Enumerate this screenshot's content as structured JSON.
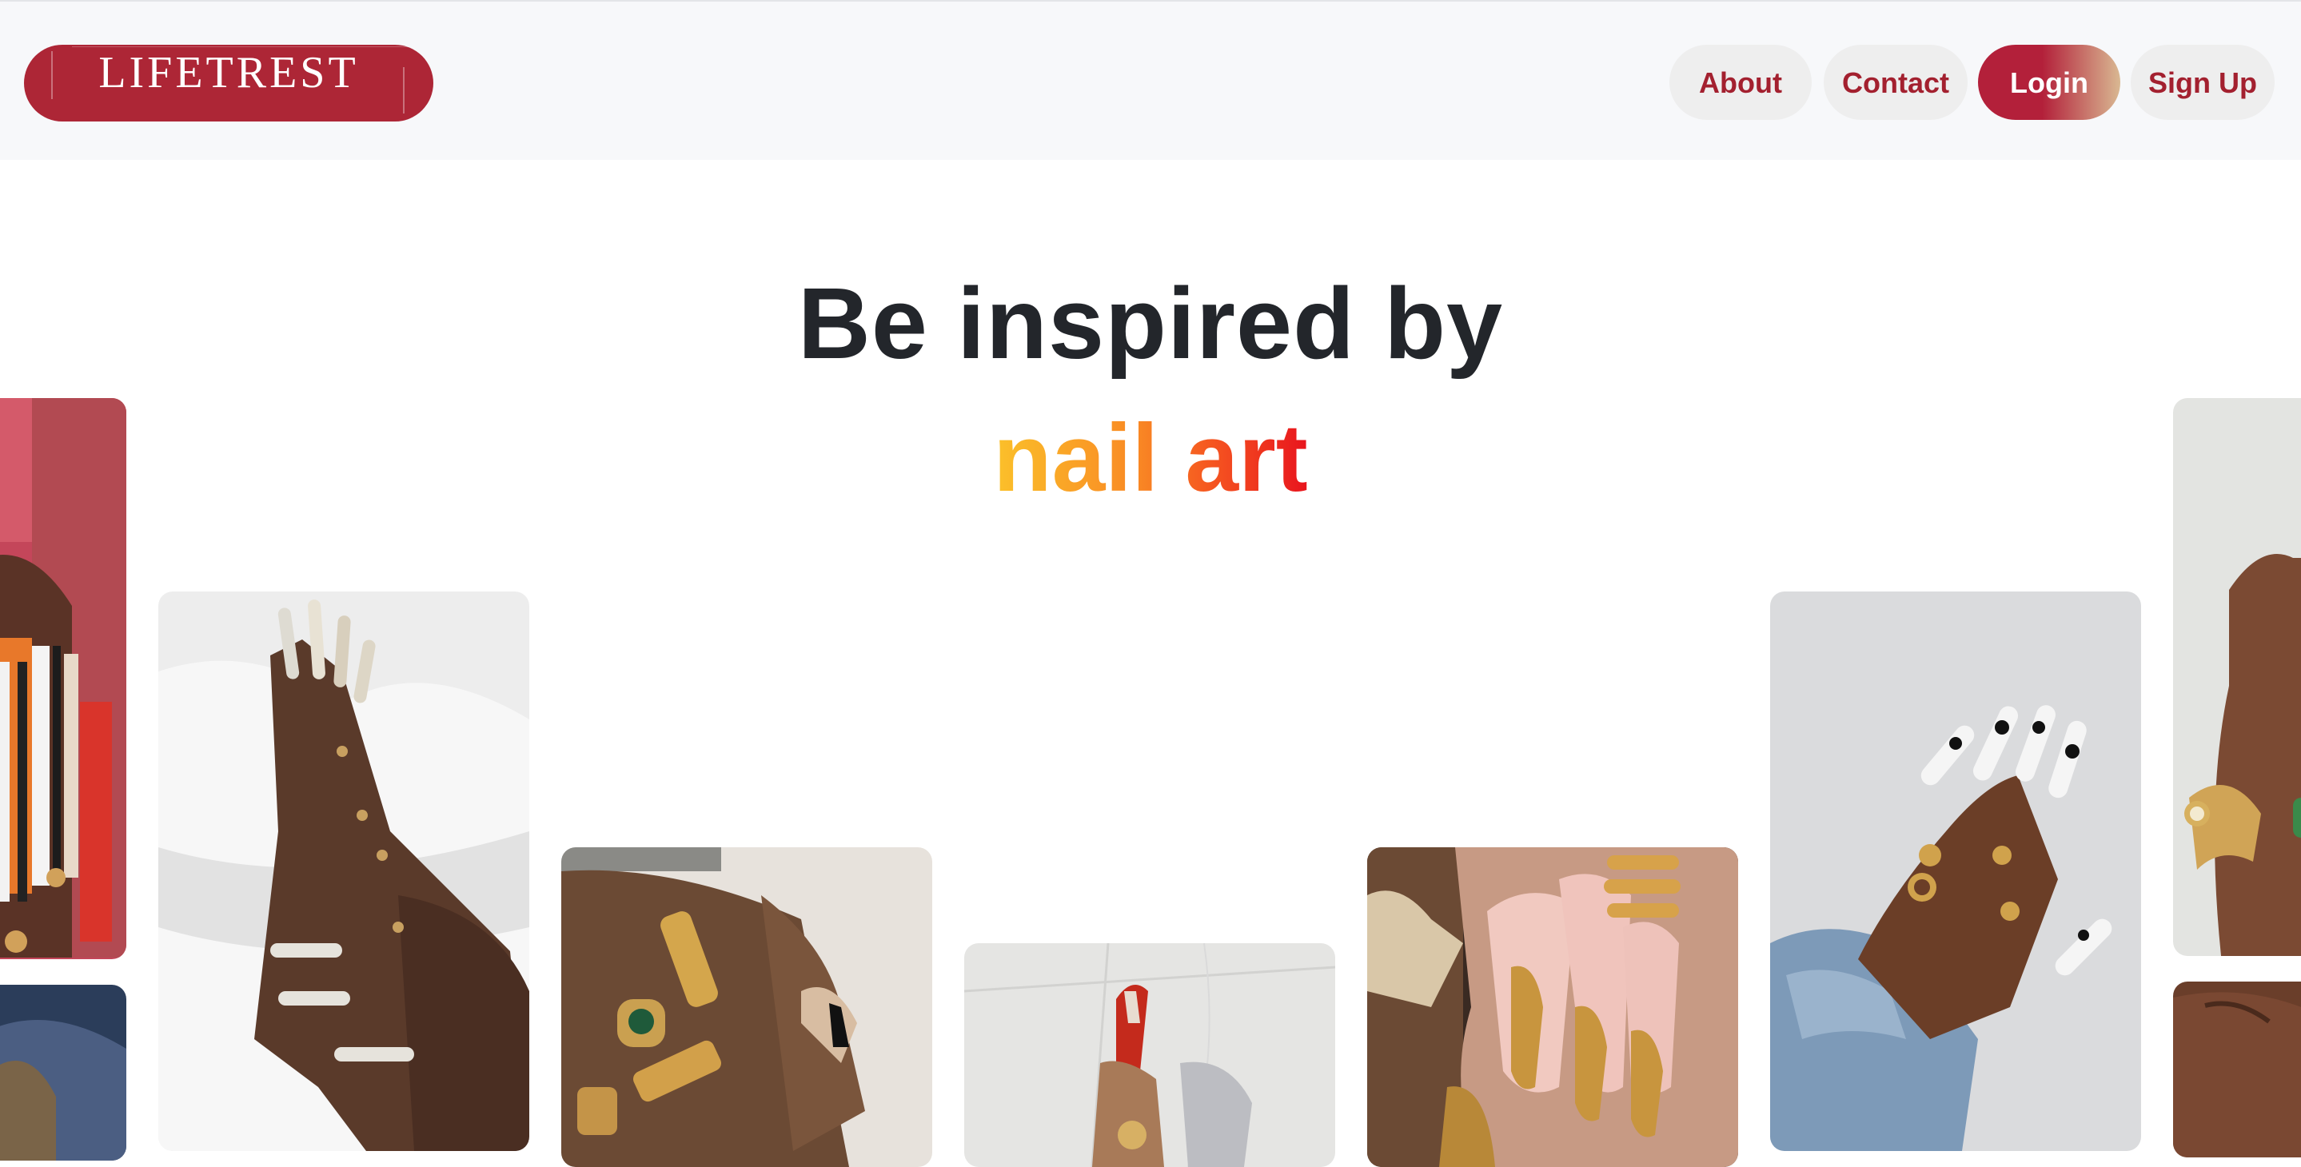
{
  "header": {
    "logo_text": "LIFETREST",
    "nav": {
      "about_label": "About",
      "contact_label": "Contact",
      "login_label": "Login",
      "signup_label": "Sign Up"
    }
  },
  "hero": {
    "headline": "Be inspired by",
    "subheadline": "nail art"
  },
  "colors": {
    "brand": "#ad2636",
    "nav_text": "#a3202f",
    "headline": "#23262b",
    "gradient_start": "#fbc12a",
    "gradient_end": "#e8141d"
  },
  "gallery": {
    "images": [
      {
        "name": "nail-photo-orange-stripes"
      },
      {
        "name": "nail-photo-dark-blue"
      },
      {
        "name": "nail-photo-white-fur"
      },
      {
        "name": "nail-photo-gold-rings"
      },
      {
        "name": "nail-photo-red-marble"
      },
      {
        "name": "nail-photo-gold-filigree"
      },
      {
        "name": "nail-photo-cow-print"
      },
      {
        "name": "nail-photo-bracelet"
      },
      {
        "name": "nail-photo-dark-skin"
      }
    ]
  }
}
